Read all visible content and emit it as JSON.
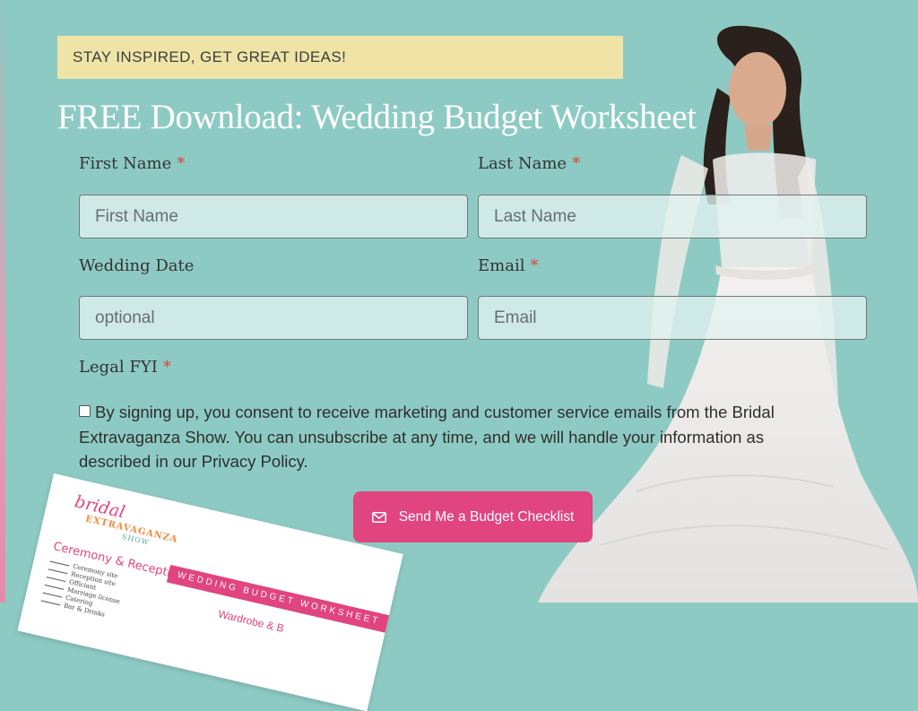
{
  "banner": {
    "text": "STAY INSPIRED, GET GREAT IDEAS!"
  },
  "title": "FREE Download: Wedding Budget Worksheet",
  "form": {
    "first_name": {
      "label": "First Name",
      "required": "*",
      "placeholder": "First Name"
    },
    "last_name": {
      "label": "Last Name",
      "required": "*",
      "placeholder": "Last Name"
    },
    "wedding_date": {
      "label": "Wedding Date",
      "placeholder": "optional"
    },
    "email": {
      "label": "Email",
      "required": "*",
      "placeholder": "Email"
    },
    "legal": {
      "label": "Legal FYI",
      "required": "*"
    },
    "consent_text": "By signing up, you consent to receive marketing and customer service emails from the Bridal Extravaganza Show. You can unsubscribe at any time, and we will handle your information as described in our Privacy Policy.",
    "submit_label": "Send Me a Budget Checklist"
  },
  "worksheet": {
    "brand_line1": "bridal",
    "brand_line2": "EXTRAVAGANZA",
    "brand_line3": "SHOW",
    "stripe": "WEDDING BUDGET WORKSHEET",
    "section": "Ceremony & Reception",
    "items": [
      "Ceremony site",
      "Reception site",
      "Officiant",
      "Marriage license",
      "Catering",
      "Bar & Drinks"
    ],
    "sub_section": "Wardrobe & B"
  },
  "colors": {
    "background": "#8ecac4",
    "banner": "#efe4a6",
    "accent": "#e0457f",
    "required": "#d6463c"
  }
}
